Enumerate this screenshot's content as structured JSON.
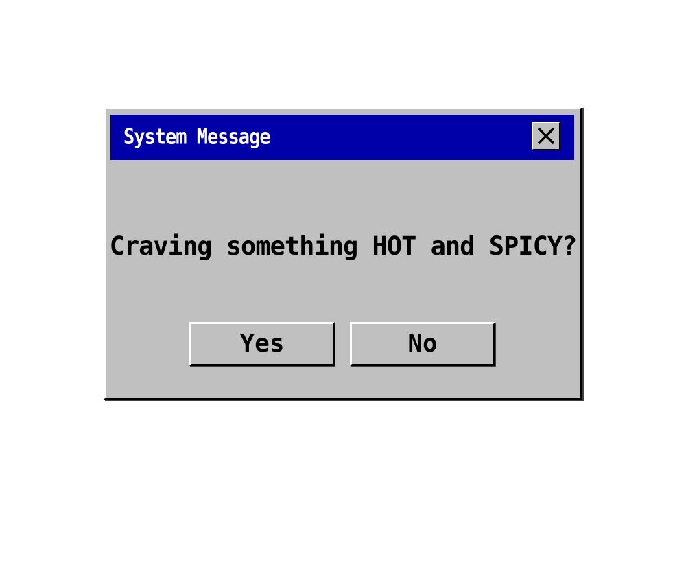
{
  "dialog": {
    "title": "System Message",
    "message": "Craving something HOT and SPICY?",
    "close_icon": "close-icon",
    "buttons": {
      "yes_label": "Yes",
      "no_label": "No"
    }
  },
  "colors": {
    "titlebar": "#0000a8",
    "dialog_bg": "#c0c0c0",
    "title_text": "#ffffff",
    "text": "#000000"
  }
}
